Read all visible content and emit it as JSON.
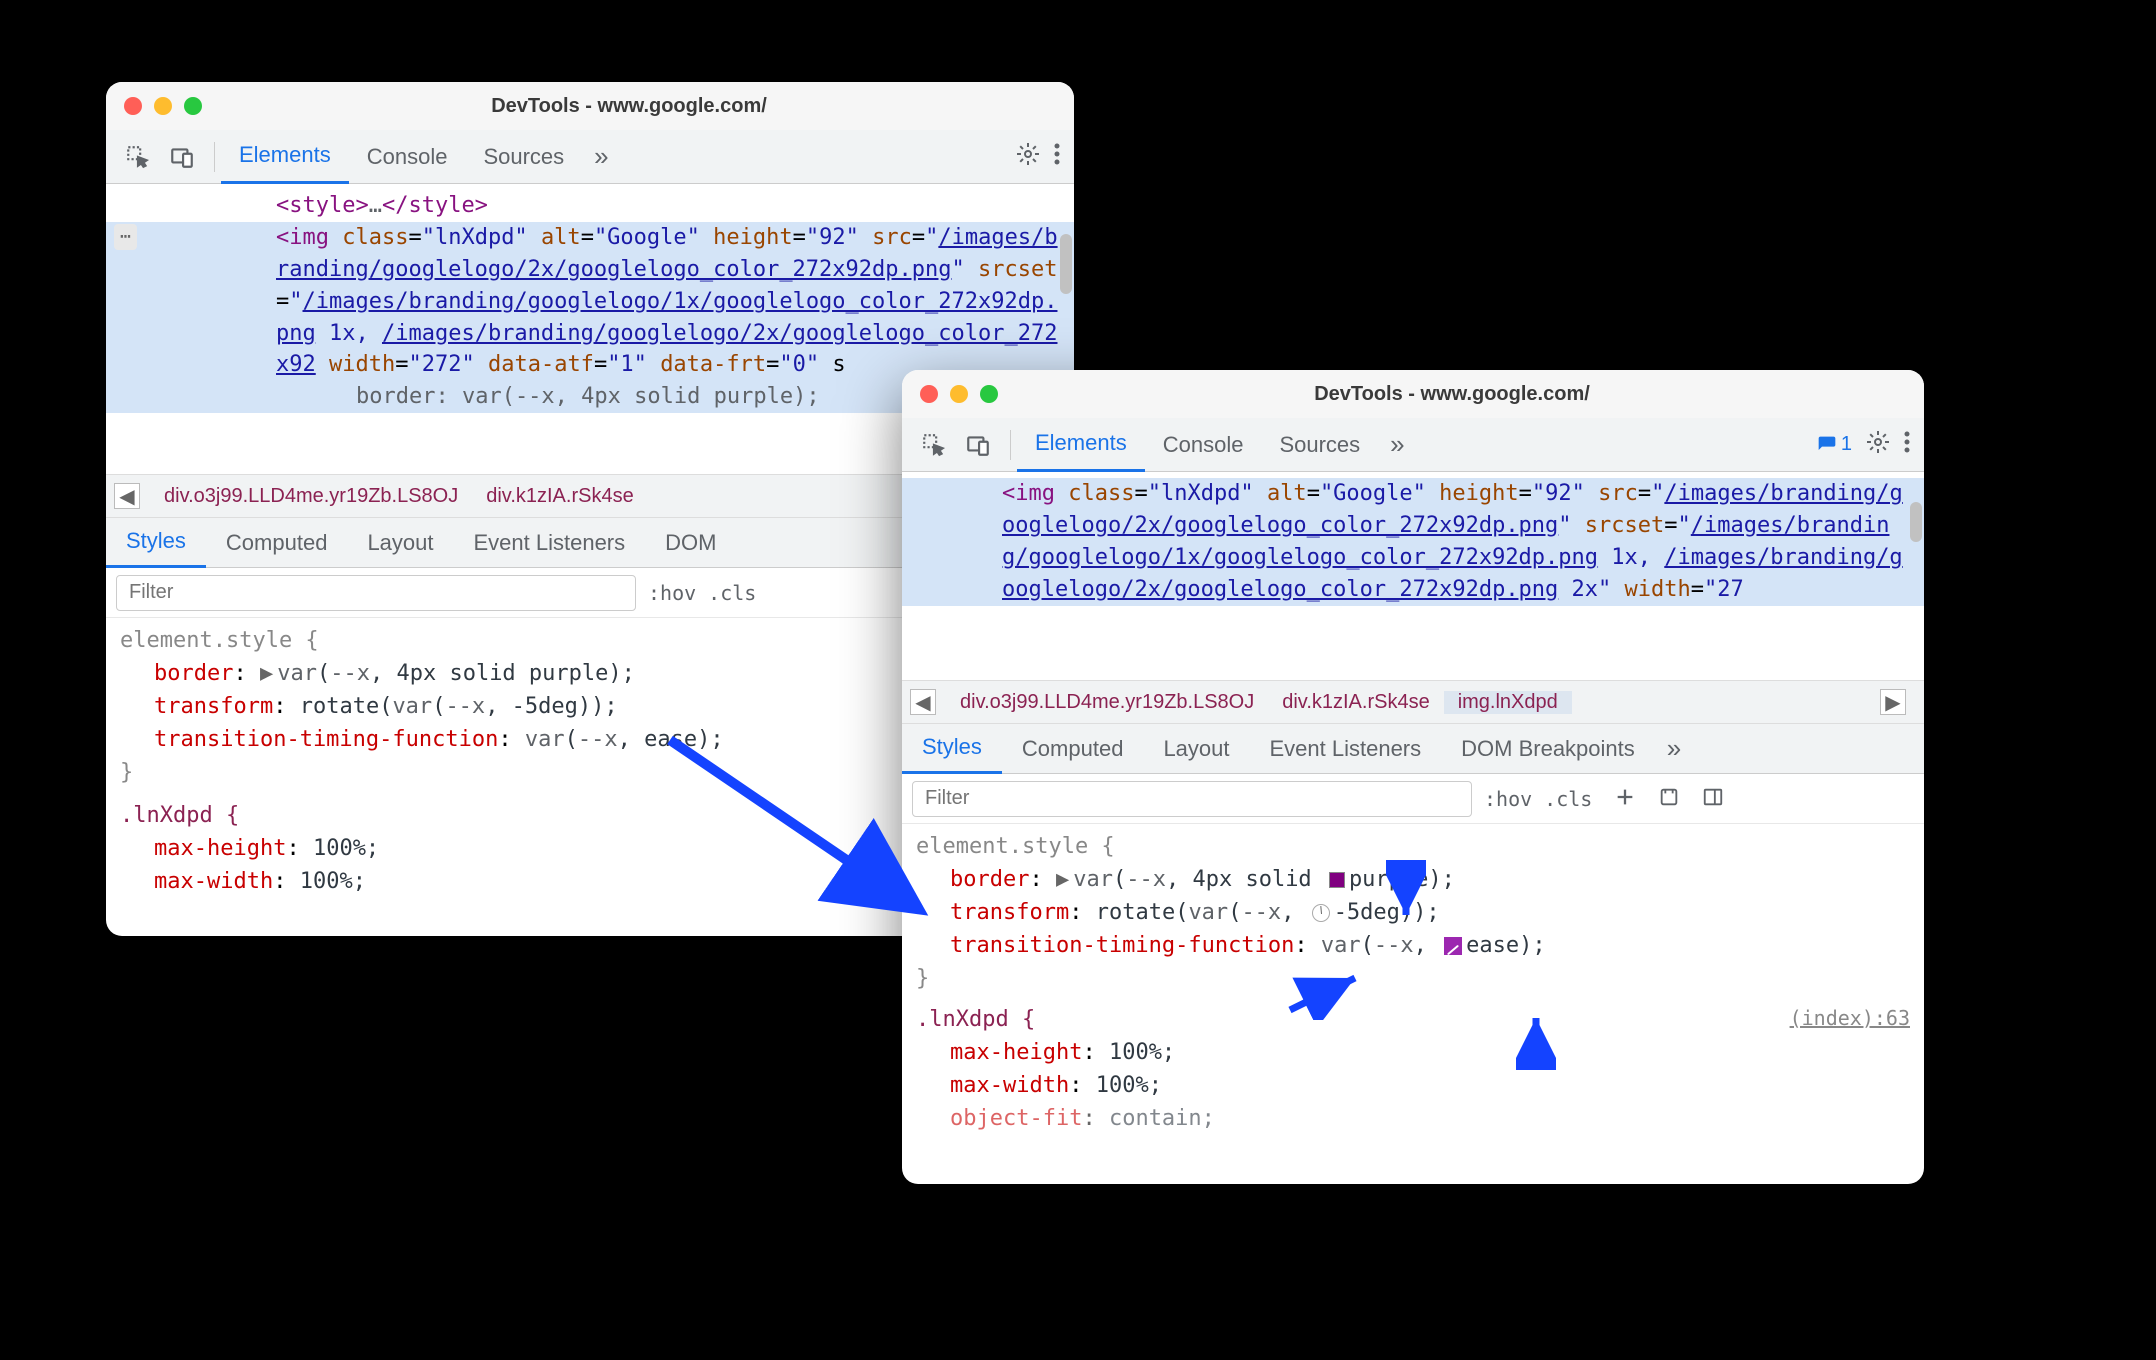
{
  "win1": {
    "title": "DevTools - www.google.com/",
    "tabs": {
      "elements": "Elements",
      "console": "Console",
      "sources": "Sources"
    },
    "dom": {
      "style_close": "<style>…</style>",
      "img_open": "<img",
      "class_attr": "class",
      "class_val": "\"lnXdpd\"",
      "alt_attr": "alt",
      "alt_val": "\"Google\"",
      "height_attr": "height",
      "height_val": "\"92\"",
      "src_attr": "src",
      "src_link": "/images/branding/googlelogo/2x/googlelogo_color_272x92dp.png",
      "srcset_attr": "srcset",
      "srcset_link1": "/images/branding/googlelogo/1x/googlelogo_color_272x92dp.png",
      "srcset_1x": " 1x, ",
      "srcset_link2": "/images/branding/googlelogo/2x/googlelogo_color_272x92",
      "width_attr": "width",
      "width_val": "\"272\"",
      "atf_attr": "data-atf",
      "atf_val": "\"1\"",
      "frt_attr": "data-frt",
      "frt_val": "\"0\"",
      "inline_style": "border: var(--x, 4px solid purple);"
    },
    "crumbs": {
      "c1": "div.o3j99.LLD4me.yr19Zb.LS8OJ",
      "c2": "div.k1zIA.rSk4se"
    },
    "style_tabs": {
      "styles": "Styles",
      "computed": "Computed",
      "layout": "Layout",
      "listeners": "Event Listeners",
      "dom_bp": "DOM"
    },
    "filter_placeholder": "Filter",
    "hov": ":hov",
    "cls": ".cls",
    "rules": {
      "el_style": "element.style {",
      "border_prop": "border",
      "border_val": "var(--x, 4px solid purple);",
      "transform_prop": "transform",
      "transform_val": "rotate(var(--x, -5deg));",
      "ttf_prop": "transition-timing-function",
      "ttf_val": "var(--x, ease);",
      "close": "}",
      "sel2": ".lnXdpd {",
      "mh_prop": "max-height",
      "mh_val": "100%;",
      "mw_prop": "max-width",
      "mw_val": "100%;"
    }
  },
  "win2": {
    "title": "DevTools - www.google.com/",
    "tabs": {
      "elements": "Elements",
      "console": "Console",
      "sources": "Sources"
    },
    "msg_count": "1",
    "dom": {
      "img_open": "<img",
      "class_attr": "class",
      "class_val": "\"lnXdpd\"",
      "alt_attr": "alt",
      "alt_val": "\"Google\"",
      "height_attr": "height",
      "height_val": "\"92\"",
      "src_attr": "src",
      "src_link": "/images/branding/googlelogo/2x/googlelogo_color_272x92dp.png",
      "srcset_attr": "srcset",
      "srcset_link1": "/images/branding/googlelogo/1x/googlelogo_color_272x92dp.png",
      "srcset_1x": " 1x, ",
      "srcset_link2": "/images/branding/googlelogo/2x/googlelogo_color_272x92dp.png",
      "srcset_2x": " 2x\"",
      "width_attr": "width",
      "width_val": "\"27"
    },
    "crumbs": {
      "c1": "div.o3j99.LLD4me.yr19Zb.LS8OJ",
      "c2": "div.k1zIA.rSk4se",
      "c3": "img.lnXdpd"
    },
    "style_tabs": {
      "styles": "Styles",
      "computed": "Computed",
      "layout": "Layout",
      "listeners": "Event Listeners",
      "dom_bp": "DOM Breakpoints"
    },
    "filter_placeholder": "Filter",
    "hov": ":hov",
    "cls": ".cls",
    "rules": {
      "el_style": "element.style {",
      "border_prop": "border",
      "border_pre": "var(--x, 4px solid ",
      "border_color": "purple",
      "border_post": ");",
      "transform_prop": "transform",
      "transform_pre": "rotate(var(--x, ",
      "transform_deg": "-5deg",
      "transform_post": "));",
      "ttf_prop": "transition-timing-function",
      "ttf_pre": "var(--x, ",
      "ttf_ease": "ease",
      "ttf_post": ");",
      "close": "}",
      "sel2": ".lnXdpd {",
      "src_link": "(index):63",
      "mh_prop": "max-height",
      "mh_val": "100%;",
      "mw_prop": "max-width",
      "mw_val": "100%;",
      "of_prop": "object-fit",
      "of_val": "contain;"
    }
  }
}
